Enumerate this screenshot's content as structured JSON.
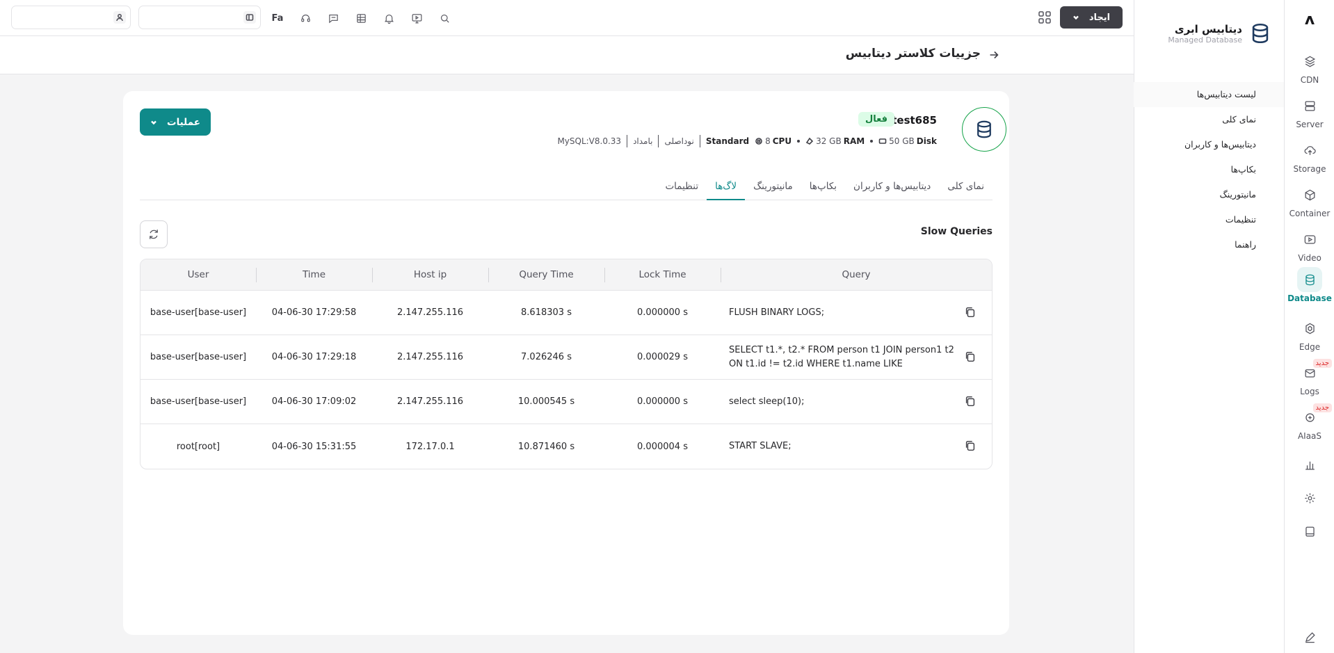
{
  "app": {
    "logo_glyph": "ʌ",
    "title": "دیتابیس ابری",
    "subtitle": "Managed Database"
  },
  "rail": {
    "items": [
      {
        "label": "CDN",
        "icon": "cdn-icon"
      },
      {
        "label": "Server",
        "icon": "server-icon"
      },
      {
        "label": "Storage",
        "icon": "storage-icon"
      },
      {
        "label": "Container",
        "icon": "container-icon"
      },
      {
        "label": "Video",
        "icon": "video-icon"
      },
      {
        "label": "Database",
        "icon": "database-icon",
        "active": true
      },
      {
        "label": "Edge",
        "icon": "edge-icon"
      },
      {
        "label": "Logs",
        "icon": "logs-icon",
        "badge": "جدید"
      },
      {
        "label": "AIaaS",
        "icon": "aiaas-icon",
        "badge": "جدید"
      }
    ],
    "new_badge": "جدید"
  },
  "subnav": {
    "items": [
      "لیست دیتابیس‌ها",
      "نمای کلی",
      "دیتابیس‌ها و کاربران",
      "بکاپ‌ها",
      "مانیتورینگ",
      "تنظیمات",
      "راهنما"
    ]
  },
  "topbar": {
    "create_label": "ایجاد",
    "lang": "Fa",
    "search_placeholder": "",
    "account_placeholder": ""
  },
  "page": {
    "title": "جزییات کلاستر دیتابیس"
  },
  "cluster": {
    "name": "test685",
    "status": "فعال",
    "disk_value": "50 GB",
    "disk_label": "Disk",
    "ram_value": "32 GB",
    "ram_label": "RAM",
    "cpu_value": "8",
    "cpu_label": "CPU",
    "plan": "Standard",
    "region": "نوداصلی",
    "type": "بامداد",
    "version": "MySQL:V8.0.33",
    "ops_label": "عملیات"
  },
  "tabs": [
    "نمای کلی",
    "دیتابیس‌ها و کاربران",
    "بکاپ‌ها",
    "مانیتورینگ",
    "لاگ‌ها",
    "تنظیمات"
  ],
  "active_tab": "لاگ‌ها",
  "slow_queries": {
    "title": "Slow Queries",
    "columns": {
      "query": "Query",
      "lock_time": "Lock Time",
      "query_time": "Query Time",
      "host_ip": "Host ip",
      "time": "Time",
      "user": "User"
    },
    "rows": [
      {
        "query": "FLUSH BINARY LOGS;",
        "lock_time": "0.000000 s",
        "query_time": "8.618303 s",
        "host_ip": "2.147.255.116",
        "time": "04-06-30 17:29:58",
        "user": "base-user[base-user]"
      },
      {
        "query": "SELECT t1.*, t2.* FROM person t1 JOIN person1 t2 ON t1.id != t2.id WHERE t1.name LIKE",
        "lock_time": "0.000029 s",
        "query_time": "7.026246 s",
        "host_ip": "2.147.255.116",
        "time": "04-06-30 17:29:18",
        "user": "base-user[base-user]"
      },
      {
        "query": "select sleep(10);",
        "lock_time": "0.000000 s",
        "query_time": "10.000545 s",
        "host_ip": "2.147.255.116",
        "time": "04-06-30 17:09:02",
        "user": "base-user[base-user]"
      },
      {
        "query": "START SLAVE;",
        "lock_time": "0.000004 s",
        "query_time": "10.871460 s",
        "host_ip": "172.17.0.1",
        "time": "04-06-30 15:31:55",
        "user": "root[root]"
      }
    ]
  },
  "colors": {
    "accent": "#0f8a8a",
    "status_active_bg": "#dcfce7",
    "status_active_text": "#15803d",
    "create_button_bg": "#3f3f46"
  }
}
